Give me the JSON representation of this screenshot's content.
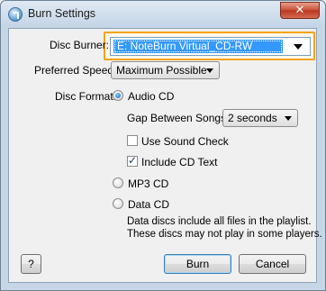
{
  "window": {
    "title": "Burn Settings",
    "close_label": "✕"
  },
  "disc_burner": {
    "label": "Disc Burner:",
    "value": "E: NoteBurn Virtual_CD-RW"
  },
  "preferred_speed": {
    "label": "Preferred Speed:",
    "value": "Maximum Possible"
  },
  "disc_format": {
    "label": "Disc Format:",
    "options": {
      "audio_cd": {
        "label": "Audio CD",
        "selected": true
      },
      "mp3_cd": {
        "label": "MP3 CD",
        "selected": false
      },
      "data_cd": {
        "label": "Data CD",
        "selected": false
      }
    },
    "gap": {
      "label": "Gap Between Songs:",
      "value": "2 seconds"
    },
    "use_sound_check": {
      "label": "Use Sound Check",
      "checked": false
    },
    "include_cd_text": {
      "label": "Include CD Text",
      "checked": true
    },
    "data_note_line1": "Data discs include all files in the playlist.",
    "data_note_line2": "These discs may not play in some players."
  },
  "buttons": {
    "help": "?",
    "burn": "Burn",
    "cancel": "Cancel"
  },
  "colors": {
    "highlight_border": "#f5a21c",
    "selection": "#3399ff"
  }
}
